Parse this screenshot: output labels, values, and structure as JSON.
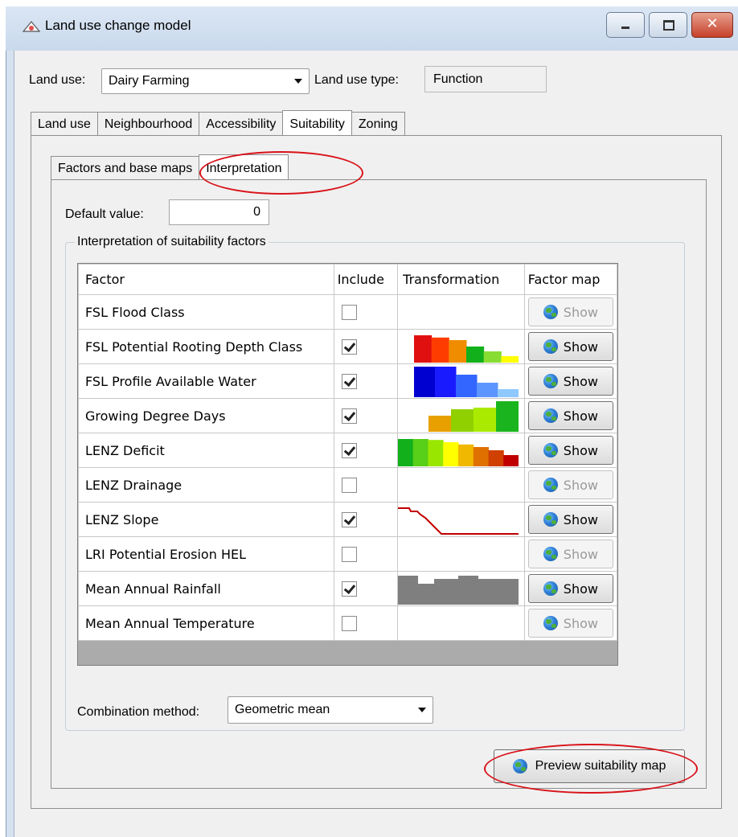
{
  "window": {
    "title": "Land use change model"
  },
  "top": {
    "land_use_label": "Land use:",
    "land_use_value": "Dairy Farming",
    "land_use_type_label": "Land use type:",
    "land_use_type_value": "Function"
  },
  "main_tabs": [
    "Land use",
    "Neighbourhood",
    "Accessibility",
    "Suitability",
    "Zoning"
  ],
  "main_tabs_active": "Suitability",
  "sub_tabs": [
    "Factors and base maps",
    "Interpretation"
  ],
  "sub_tabs_active": "Interpretation",
  "default_value": {
    "label": "Default value:",
    "value": "0"
  },
  "group_title": "Interpretation of suitability factors",
  "table": {
    "headers": [
      "Factor",
      "Include",
      "Transformation",
      "Factor map"
    ],
    "show_label": "Show",
    "rows": [
      {
        "factor": "FSL Flood Class",
        "include": false,
        "transformation": "none"
      },
      {
        "factor": "FSL Potential Rooting Depth Class",
        "include": true,
        "transformation": "bars",
        "colors": [
          "#e01010",
          "#ff3c00",
          "#f08c00",
          "#12b01a",
          "#88dd33",
          "#ffff00"
        ],
        "values": [
          0.85,
          0.78,
          0.7,
          0.5,
          0.35,
          0.2
        ]
      },
      {
        "factor": "FSL Profile Available Water",
        "include": true,
        "transformation": "bars",
        "colors": [
          "#0000d0",
          "#1a1aff",
          "#3366ff",
          "#5c95ff",
          "#8ec8ff"
        ],
        "values": [
          0.95,
          0.95,
          0.7,
          0.45,
          0.25
        ]
      },
      {
        "factor": "Growing Degree Days",
        "include": true,
        "transformation": "bars",
        "colors": [
          "#e8a000",
          "#90d000",
          "#aaea00",
          "#1ab51e"
        ],
        "values": [
          0.5,
          0.7,
          0.75,
          0.95
        ]
      },
      {
        "factor": "LENZ Deficit",
        "include": true,
        "transformation": "bars",
        "colors": [
          "#12b01a",
          "#58cf18",
          "#99e600",
          "#ffff00",
          "#f0b800",
          "#e07000",
          "#d04000",
          "#c00000"
        ],
        "values": [
          0.85,
          0.85,
          0.82,
          0.75,
          0.68,
          0.6,
          0.5,
          0.35
        ]
      },
      {
        "factor": "LENZ Drainage",
        "include": false,
        "transformation": "none"
      },
      {
        "factor": "LENZ Slope",
        "include": true,
        "transformation": "line",
        "color": "#c00000"
      },
      {
        "factor": "LRI Potential Erosion HEL",
        "include": false,
        "transformation": "none"
      },
      {
        "factor": "Mean Annual Rainfall",
        "include": true,
        "transformation": "step",
        "color": "#7f7f7f"
      },
      {
        "factor": "Mean Annual Temperature",
        "include": false,
        "transformation": "none"
      }
    ]
  },
  "combination": {
    "label": "Combination method:",
    "value": "Geometric mean"
  },
  "preview_button": "Preview suitability map"
}
